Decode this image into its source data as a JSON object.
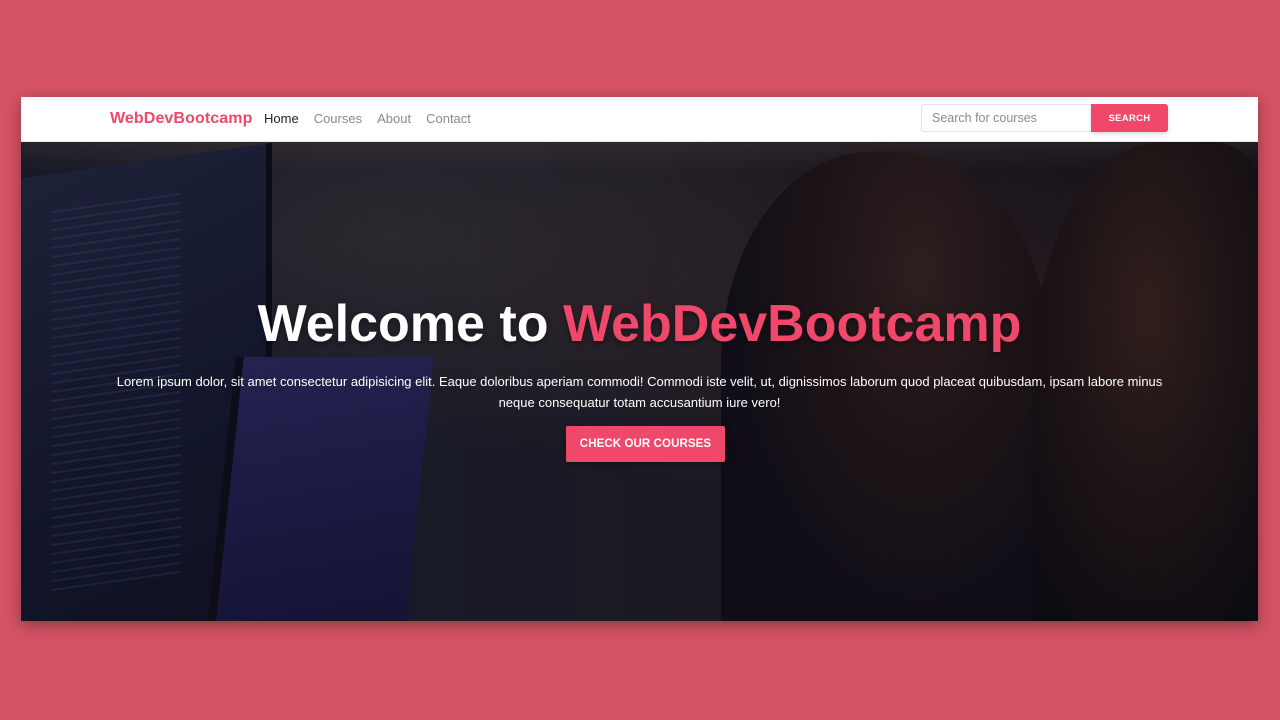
{
  "colors": {
    "accent": "#f0486b",
    "page_background": "#d45364",
    "nav_background": "#ffffff",
    "nav_link": "#8a8a8a",
    "nav_link_active": "#222222",
    "hero_text": "#ffffff"
  },
  "navbar": {
    "brand": "WebDevBootcamp",
    "links": [
      {
        "label": "Home",
        "active": true
      },
      {
        "label": "Courses",
        "active": false
      },
      {
        "label": "About",
        "active": false
      },
      {
        "label": "Contact",
        "active": false
      }
    ],
    "search": {
      "placeholder": "Search for courses",
      "value": "",
      "button_label": "SEARCH"
    }
  },
  "hero": {
    "title_prefix": "Welcome to ",
    "title_accent": "WebDevBootcamp",
    "text": "Lorem ipsum dolor, sit amet consectetur adipisicing elit. Eaque doloribus aperiam commodi! Commodi iste velit, ut, dignissimos laborum quod placeat quibusdam, ipsam labore minus neque consequatur totam accusantium iure vero!",
    "cta_label": "CHECK OUR COURSES"
  }
}
